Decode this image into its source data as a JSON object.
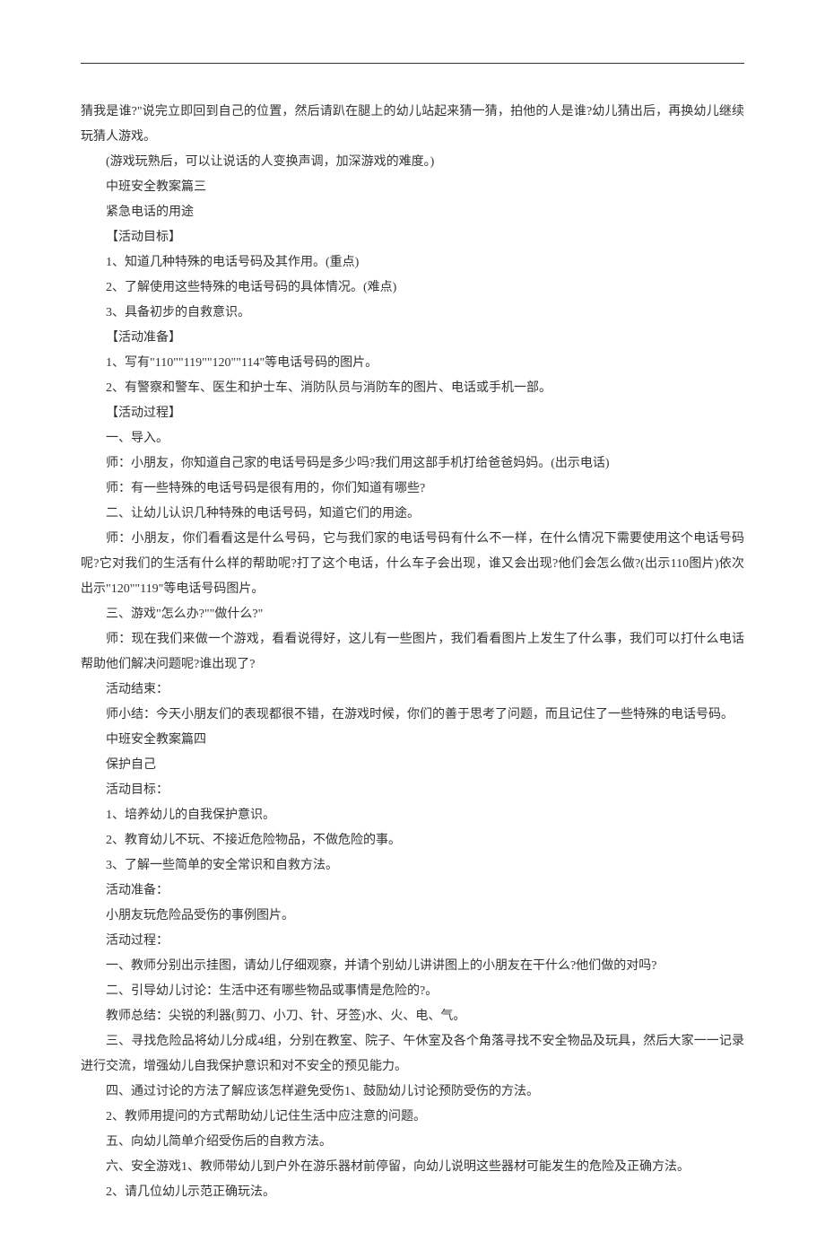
{
  "paragraphs": [
    {
      "text": "猜我是谁?\"说完立即回到自己的位置，然后请趴在腿上的幼儿站起来猜一猜，拍他的人是谁?幼儿猜出后，再换幼儿继续玩猜人游戏。",
      "indent": false
    },
    {
      "text": "(游戏玩熟后，可以让说话的人变换声调，加深游戏的难度。)",
      "indent": true
    },
    {
      "text": "中班安全教案篇三",
      "indent": true
    },
    {
      "text": "紧急电话的用途",
      "indent": true
    },
    {
      "text": "【活动目标】",
      "indent": true
    },
    {
      "text": "1、知道几种特殊的电话号码及其作用。(重点)",
      "indent": true
    },
    {
      "text": "2、了解使用这些特殊的电话号码的具体情况。(难点)",
      "indent": true
    },
    {
      "text": "3、具备初步的自救意识。",
      "indent": true
    },
    {
      "text": "【活动准备】",
      "indent": true
    },
    {
      "text": "1、写有\"110\"\"119\"\"120\"\"114\"等电话号码的图片。",
      "indent": true
    },
    {
      "text": "2、有警察和警车、医生和护士车、消防队员与消防车的图片、电话或手机一部。",
      "indent": true
    },
    {
      "text": "【活动过程】",
      "indent": true
    },
    {
      "text": "一、导入。",
      "indent": true
    },
    {
      "text": "师：小朋友，你知道自己家的电话号码是多少吗?我们用这部手机打给爸爸妈妈。(出示电话)",
      "indent": true
    },
    {
      "text": "师：有一些特殊的电话号码是很有用的，你们知道有哪些?",
      "indent": true
    },
    {
      "text": "二、让幼儿认识几种特殊的电话号码，知道它们的用途。",
      "indent": true
    },
    {
      "text": "师：小朋友，你们看看这是什么号码，它与我们家的电话号码有什么不一样，在什么情况下需要使用这个电话号码呢?它对我们的生活有什么样的帮助呢?打了这个电话，什么车子会出现，谁又会出现?他们会怎么做?(出示110图片)依次出示\"120\"\"119\"等电话号码图片。",
      "indent": true
    },
    {
      "text": "三、游戏\"怎么办?\"\"做什么?\"",
      "indent": true
    },
    {
      "text": "师：现在我们来做一个游戏，看看说得好，这儿有一些图片，我们看看图片上发生了什么事，我们可以打什么电话帮助他们解决问题呢?谁出现了?",
      "indent": true
    },
    {
      "text": "活动结束：",
      "indent": true
    },
    {
      "text": "师小结：今天小朋友们的表现都很不错，在游戏时候，你们的善于思考了问题，而且记住了一些特殊的电话号码。",
      "indent": true
    },
    {
      "text": "中班安全教案篇四",
      "indent": true
    },
    {
      "text": "保护自己",
      "indent": true
    },
    {
      "text": "活动目标：",
      "indent": true
    },
    {
      "text": "1、培养幼儿的自我保护意识。",
      "indent": true
    },
    {
      "text": "2、教育幼儿不玩、不接近危险物品，不做危险的事。",
      "indent": true
    },
    {
      "text": "3、了解一些简单的安全常识和自救方法。",
      "indent": true
    },
    {
      "text": "活动准备：",
      "indent": true
    },
    {
      "text": "小朋友玩危险品受伤的事例图片。",
      "indent": true
    },
    {
      "text": "活动过程：",
      "indent": true
    },
    {
      "text": "一、教师分别出示挂图，请幼儿仔细观察，并请个别幼儿讲讲图上的小朋友在干什么?他们做的对吗?",
      "indent": true
    },
    {
      "text": "二、引导幼儿讨论：生活中还有哪些物品或事情是危险的?。",
      "indent": true
    },
    {
      "text": "教师总结：尖锐的利器(剪刀、小刀、针、牙签)水、火、电、气。",
      "indent": true
    },
    {
      "text": "三、寻找危险品将幼儿分成4组，分别在教室、院子、午休室及各个角落寻找不安全物品及玩具，然后大家一一记录进行交流，增强幼儿自我保护意识和对不安全的预见能力。",
      "indent": true
    },
    {
      "text": "四、通过讨论的方法了解应该怎样避免受伤1、鼓励幼儿讨论预防受伤的方法。",
      "indent": true
    },
    {
      "text": "2、教师用提问的方式帮助幼儿记住生活中应注意的问题。",
      "indent": true
    },
    {
      "text": "五、向幼儿简单介绍受伤后的自救方法。",
      "indent": true
    },
    {
      "text": "六、安全游戏1、教师带幼儿到户外在游乐器材前停留，向幼儿说明这些器材可能发生的危险及正确方法。",
      "indent": true
    },
    {
      "text": "2、请几位幼儿示范正确玩法。",
      "indent": true
    }
  ]
}
